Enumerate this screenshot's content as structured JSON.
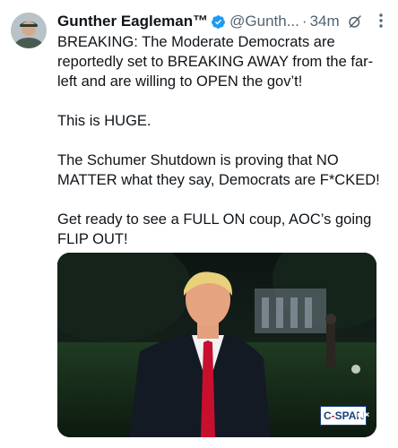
{
  "tweet": {
    "author_name": "Gunther Eagleman™",
    "handle": "@Gunth...",
    "separator": "·",
    "time": "34m",
    "paragraphs": [
      "BREAKING: The Moderate Democrats are reportedly set to BREAKING AWAY from the far-left and are willing to OPEN the gov’t!",
      "This is HUGE.",
      "The Schumer Shutdown is proving that NO MATTER what they say, Democrats are F*CKED!",
      "Get ready to see a FULL ON coup, AOC’s going FLIP OUT!"
    ],
    "media": {
      "badge_prefix": "C",
      "badge_dash": "-",
      "badge_suffix": "SPAN"
    }
  },
  "colors": {
    "verified_blue": "#1d9bf0",
    "secondary_text": "#536471",
    "primary_text": "#0f1419"
  },
  "icons": [
    "verified-badge-icon",
    "grok-icon",
    "more-options-icon",
    "volume-muted-icon"
  ]
}
